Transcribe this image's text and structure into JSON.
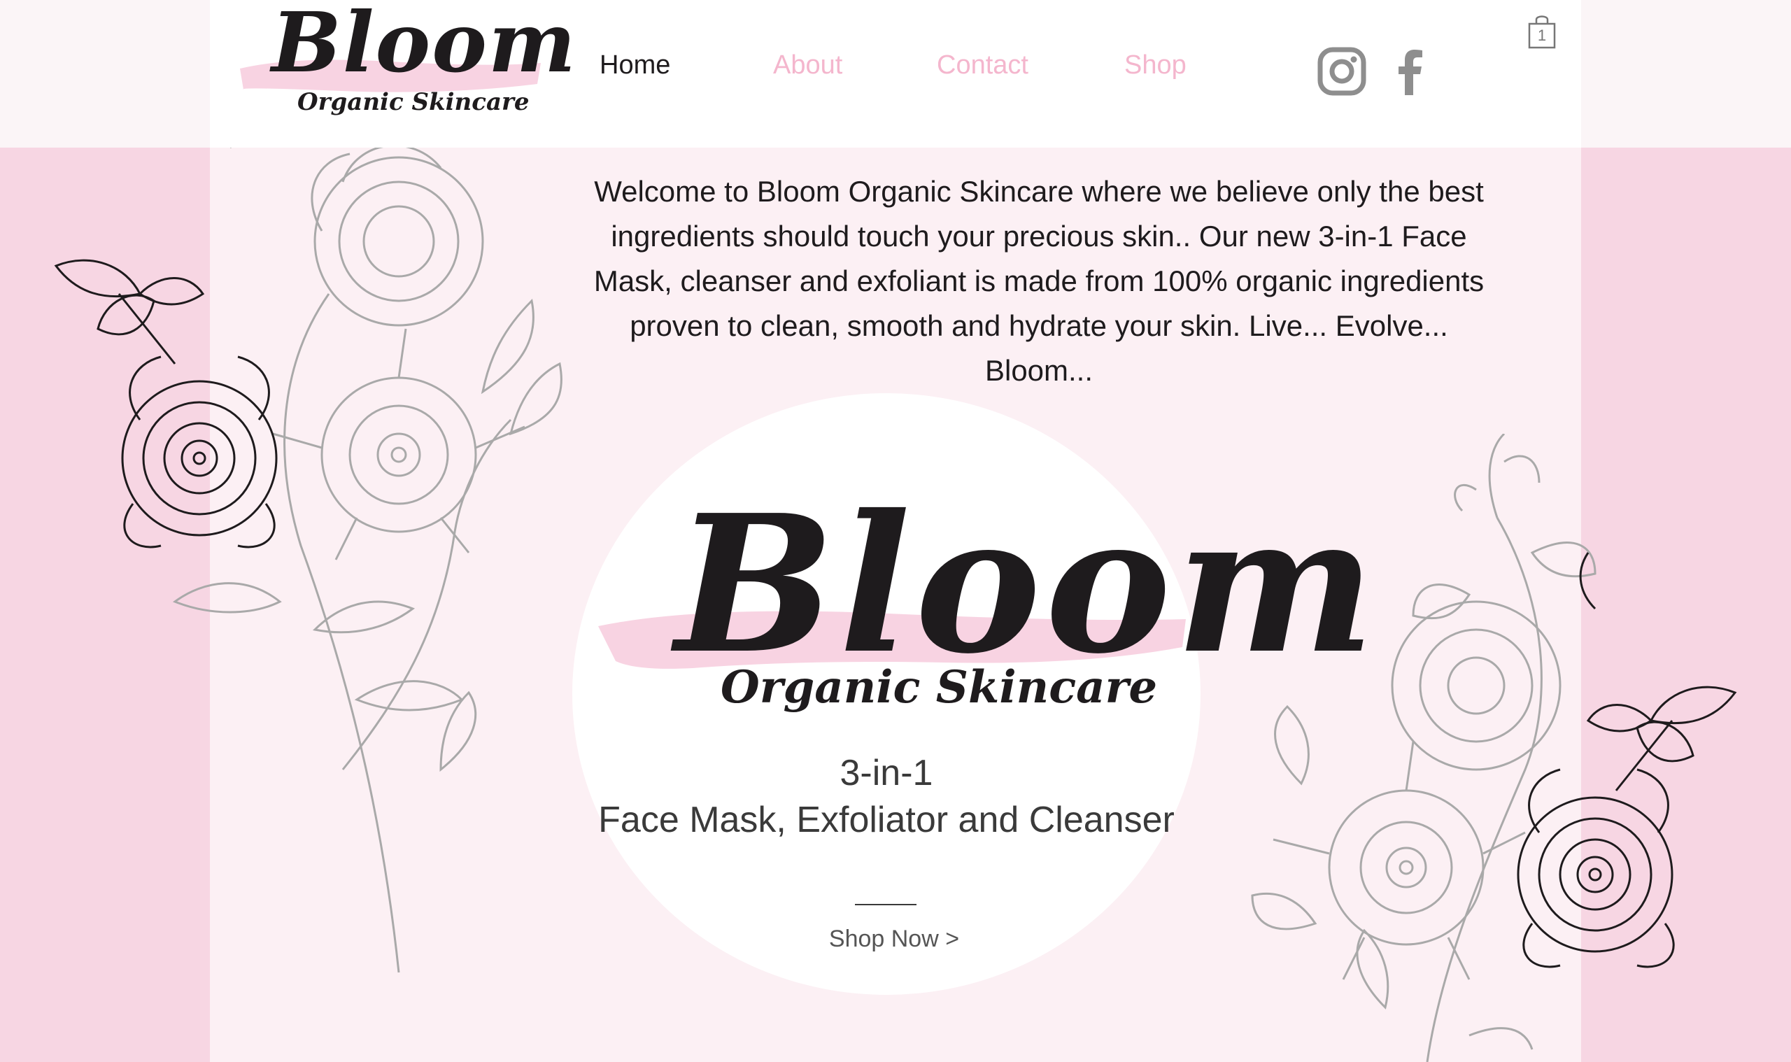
{
  "brand": {
    "name": "Bloom",
    "tagline": "Organic Skincare"
  },
  "nav": {
    "items": [
      {
        "label": "Home",
        "active": true
      },
      {
        "label": "About",
        "active": false
      },
      {
        "label": "Contact",
        "active": false
      },
      {
        "label": "Shop",
        "active": false
      }
    ]
  },
  "social": {
    "instagram_icon": "instagram-icon",
    "facebook_icon": "facebook-icon"
  },
  "cart": {
    "icon": "shopping-bag-icon",
    "count": "1"
  },
  "welcome": {
    "text": "Welcome to Bloom Organic Skincare where we believe only the best ingredients should touch your precious skin.. Our new 3-in-1 Face Mask, cleanser and exfoliant is made from 100% organic ingredients proven to clean, smooth and hydrate your skin. Live... Evolve... Bloom..."
  },
  "hero": {
    "brand_name": "Bloom",
    "brand_tagline": "Organic Skincare",
    "product_line1": "3-in-1",
    "product_line2": "Face Mask, Exfoliator and Cleanser",
    "cta": "Shop Now >"
  },
  "colors": {
    "pink_bg": "#f7d6e3",
    "pale_pink": "#fcf0f4",
    "nav_pink": "#f4b6cd",
    "brush_pink": "#f8d3e2",
    "ink": "#1e1b1d"
  }
}
